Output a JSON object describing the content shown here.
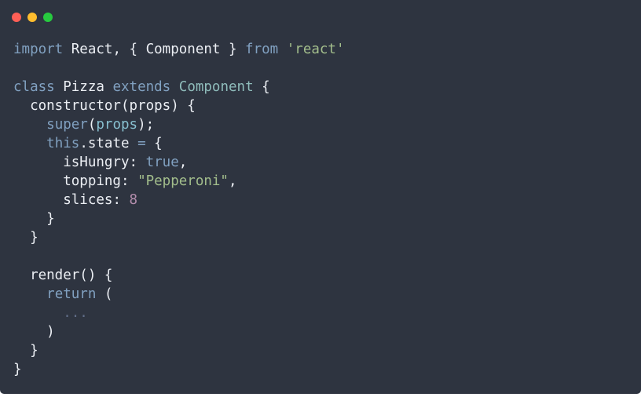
{
  "window": {
    "controls": [
      {
        "name": "close-button",
        "color": "#ff5f56"
      },
      {
        "name": "minimize-button",
        "color": "#ffbd2e"
      },
      {
        "name": "maximize-button",
        "color": "#27c93f"
      }
    ]
  },
  "theme": {
    "background": "#2e3440",
    "text": "#eceff4",
    "keyword": "#81a1c1",
    "class_name": "#8fbcbb",
    "string": "#a3be8c",
    "number": "#b48ead",
    "parameter": "#88c0d0",
    "comment": "#616e88"
  },
  "code": {
    "lines": [
      [
        [
          "keyword",
          "import"
        ],
        [
          "punct",
          " "
        ],
        [
          "ident",
          "React"
        ],
        [
          "punct",
          ", { "
        ],
        [
          "ident",
          "Component"
        ],
        [
          "punct",
          " } "
        ],
        [
          "keyword",
          "from"
        ],
        [
          "punct",
          " "
        ],
        [
          "string",
          "'react'"
        ]
      ],
      [],
      [
        [
          "keyword",
          "class"
        ],
        [
          "punct",
          " "
        ],
        [
          "ident",
          "Pizza"
        ],
        [
          "punct",
          " "
        ],
        [
          "keyword",
          "extends"
        ],
        [
          "punct",
          " "
        ],
        [
          "class",
          "Component"
        ],
        [
          "punct",
          " {"
        ]
      ],
      [
        [
          "punct",
          "  "
        ],
        [
          "func",
          "constructor"
        ],
        [
          "punct",
          "("
        ],
        [
          "ident",
          "props"
        ],
        [
          "punct",
          ") {"
        ]
      ],
      [
        [
          "punct",
          "    "
        ],
        [
          "keyword",
          "super"
        ],
        [
          "punct",
          "("
        ],
        [
          "param",
          "props"
        ],
        [
          "punct",
          ");"
        ]
      ],
      [
        [
          "punct",
          "    "
        ],
        [
          "keyword",
          "this"
        ],
        [
          "punct",
          "."
        ],
        [
          "ident",
          "state"
        ],
        [
          "punct",
          " "
        ],
        [
          "operator",
          "="
        ],
        [
          "punct",
          " {"
        ]
      ],
      [
        [
          "punct",
          "      "
        ],
        [
          "ident",
          "isHungry"
        ],
        [
          "punct",
          ": "
        ],
        [
          "keyword",
          "true"
        ],
        [
          "punct",
          ","
        ]
      ],
      [
        [
          "punct",
          "      "
        ],
        [
          "ident",
          "topping"
        ],
        [
          "punct",
          ": "
        ],
        [
          "string",
          "\"Pepperoni\""
        ],
        [
          "punct",
          ","
        ]
      ],
      [
        [
          "punct",
          "      "
        ],
        [
          "ident",
          "slices"
        ],
        [
          "punct",
          ": "
        ],
        [
          "number",
          "8"
        ]
      ],
      [
        [
          "punct",
          "    }"
        ]
      ],
      [
        [
          "punct",
          "  }"
        ]
      ],
      [],
      [
        [
          "punct",
          "  "
        ],
        [
          "func",
          "render"
        ],
        [
          "punct",
          "() {"
        ]
      ],
      [
        [
          "punct",
          "    "
        ],
        [
          "keyword",
          "return"
        ],
        [
          "punct",
          " ("
        ]
      ],
      [
        [
          "punct",
          "      "
        ],
        [
          "comment",
          "..."
        ]
      ],
      [
        [
          "punct",
          "    )"
        ]
      ],
      [
        [
          "punct",
          "  }"
        ]
      ],
      [
        [
          "punct",
          "}"
        ]
      ]
    ]
  }
}
